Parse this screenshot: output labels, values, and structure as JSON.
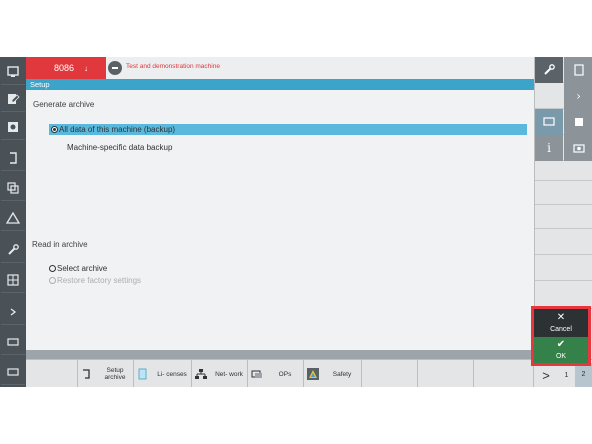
{
  "header": {
    "channel": "8086",
    "machine_text": "Test and demonstration machine"
  },
  "title": "Setup",
  "generate": {
    "label": "Generate archive",
    "options": [
      {
        "label": "All data of this machine (backup)"
      },
      {
        "label": "Machine-specific data backup"
      }
    ]
  },
  "read": {
    "label": "Read in archive",
    "options": [
      {
        "label": "Select archive"
      },
      {
        "label": "Restore factory settings"
      }
    ]
  },
  "softkeys": [
    {
      "label": "Setup archive",
      "icon": "archive-icon"
    },
    {
      "label": "Li- censes",
      "icon": "license-icon"
    },
    {
      "label": "Net- work",
      "icon": "network-icon"
    },
    {
      "label": "OPs",
      "icon": "operator-panel-icon"
    },
    {
      "label": "Safety",
      "icon": "safety-icon"
    }
  ],
  "actions": {
    "cancel": "Cancel",
    "ok": "OK"
  },
  "pages": {
    "next": ">",
    "p1": "1",
    "p2": "2"
  },
  "colors": {
    "accent": "#3da4c9",
    "alarm": "#e0383d",
    "ok": "#35814a",
    "highlight": "#e8363f"
  }
}
